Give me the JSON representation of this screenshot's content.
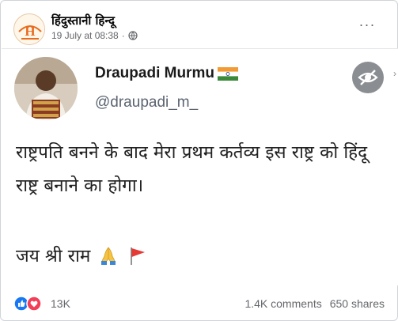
{
  "post": {
    "page_name": "हिंदुस्तानी हिन्दू",
    "timestamp": "19 July at 08:38",
    "separator": "·",
    "more_label": "···"
  },
  "tweet": {
    "display_name": "Draupadi Murmu",
    "handle": "@draupadi_m_",
    "text": "राष्ट्रपति बनने के बाद मेरा प्रथम कर्तव्य इस राष्ट्र को हिंदू राष्ट्र बनाने का होगा।",
    "slogan": "जय श्री राम",
    "chevron": "›"
  },
  "footer": {
    "reactions": "13K",
    "comments": "1.4K comments",
    "shares": "650 shares"
  },
  "icons": {
    "avatar_logo_letter": "H",
    "reactions": [
      "like-icon",
      "love-icon"
    ]
  },
  "colors": {
    "brand_blue": "#1877f2",
    "love_red": "#f33e58",
    "meta_gray": "#65676b",
    "logo_orange": "#e86c1f"
  }
}
